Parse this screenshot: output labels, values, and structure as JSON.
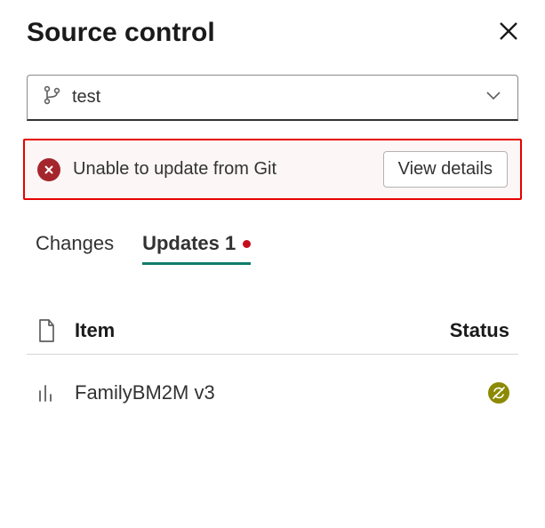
{
  "header": {
    "title": "Source control"
  },
  "branch": {
    "name": "test"
  },
  "error": {
    "message": "Unable to update from Git",
    "button": "View details"
  },
  "tabs": {
    "changes": "Changes",
    "updates": "Updates 1"
  },
  "columns": {
    "item": "Item",
    "status": "Status"
  },
  "rows": [
    {
      "name": "FamilyBM2M v3"
    }
  ]
}
